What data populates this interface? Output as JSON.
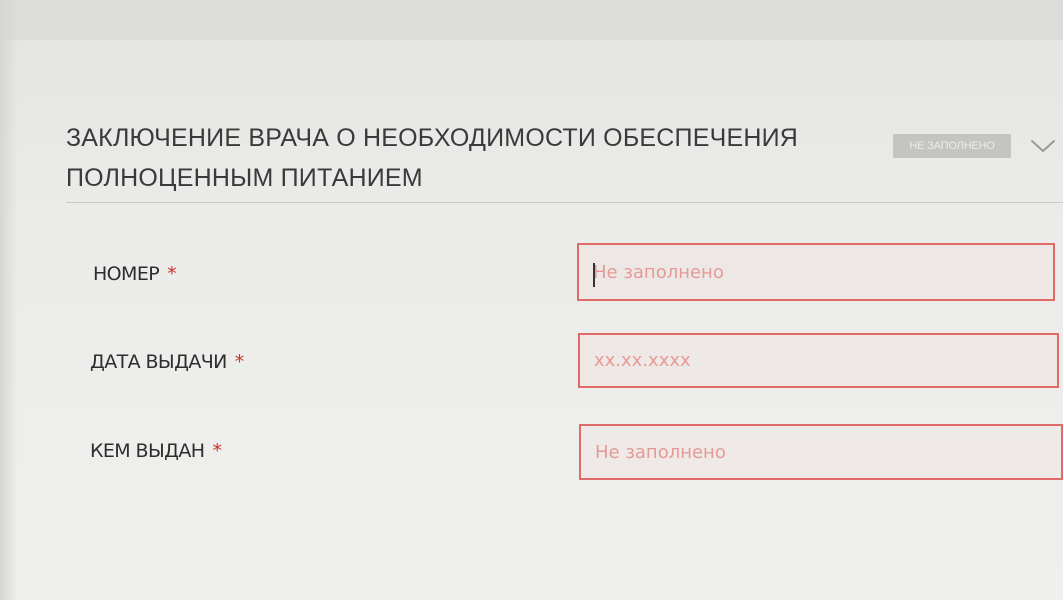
{
  "section": {
    "title_line1": "ЗАКЛЮЧЕНИЕ ВРАЧА О НЕОБХОДИМОСТИ ОБЕСПЕЧЕНИЯ",
    "title_line2": "ПОЛНОЦЕННЫМ ПИТАНИЕМ",
    "status_badge": "НЕ ЗАПОЛНЕНО"
  },
  "colors": {
    "required_marker": "#d0322b",
    "invalid_border": "#e06b66",
    "placeholder": "#e59a95",
    "badge_bg": "#c4c4c2"
  },
  "icons": {
    "expand": "chevron-down-icon"
  },
  "fields": [
    {
      "label": "НОМЕР",
      "required_mark": "*",
      "placeholder": "Не заполнено",
      "value": ""
    },
    {
      "label": "ДАТА ВЫДАЧИ",
      "required_mark": "*",
      "placeholder": "xx.xx.xxxx",
      "value": ""
    },
    {
      "label": "КЕМ ВЫДАН",
      "required_mark": "*",
      "placeholder": "Не заполнено",
      "value": ""
    }
  ]
}
